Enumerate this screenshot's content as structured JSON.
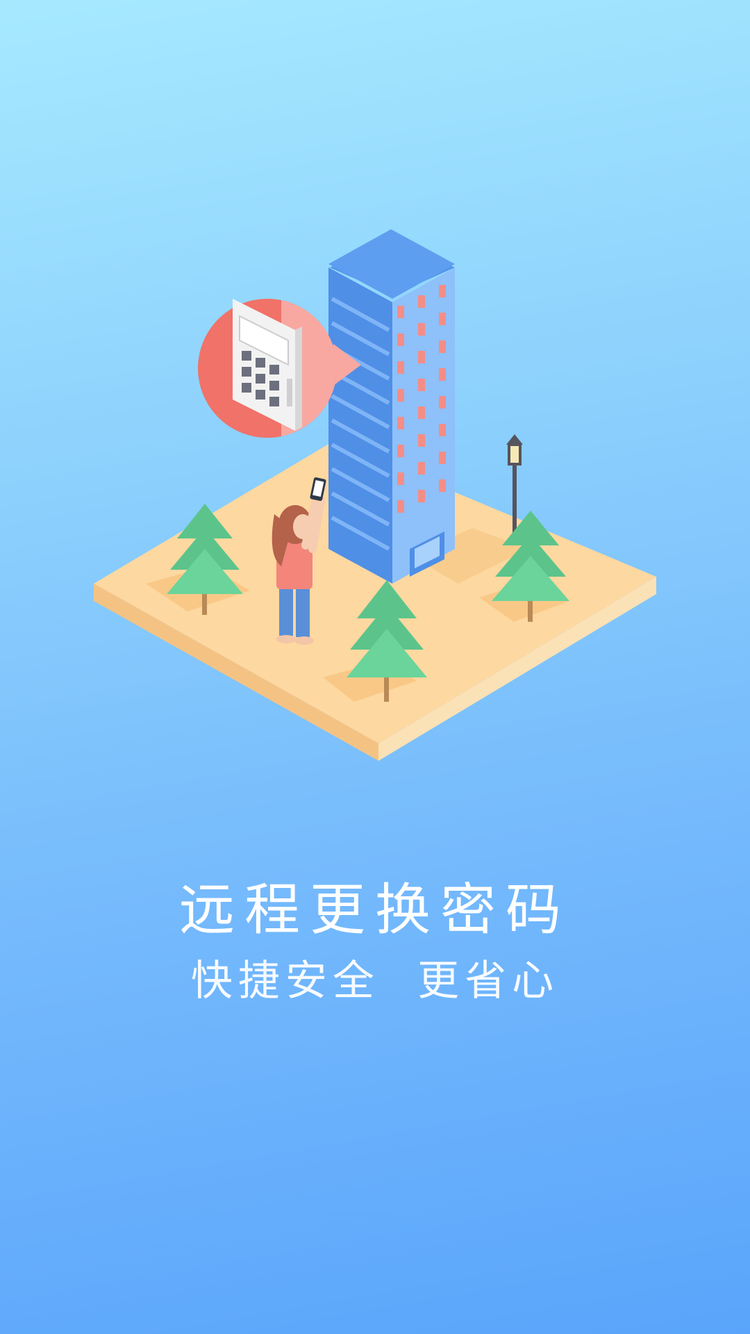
{
  "onboarding": {
    "title": "远程更换密码",
    "subtitle": "快捷安全  更省心",
    "illustration": "isometric-building-keypad-scene"
  },
  "colors": {
    "background_top": "#a6e9ff",
    "background_bottom": "#5aa5fb",
    "text": "#ffffff",
    "accent_red": "#f07268"
  }
}
